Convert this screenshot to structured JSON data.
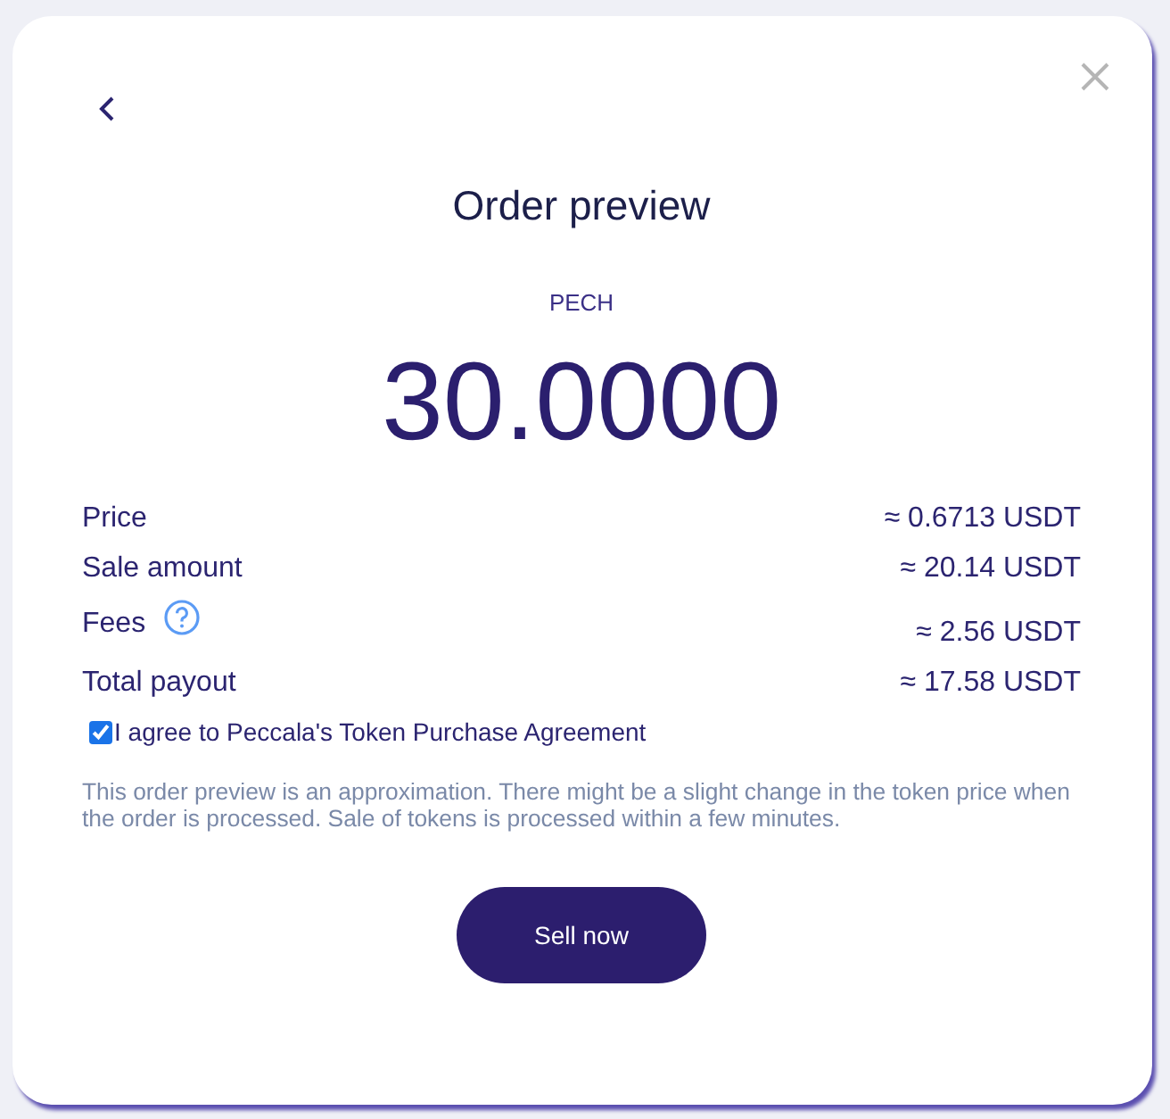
{
  "dialog": {
    "title": "Order preview",
    "token": "PECH",
    "amount": "30.0000",
    "rows": [
      {
        "kind": "plain",
        "label": "Price",
        "value": "≈ 0.6713 USDT"
      },
      {
        "kind": "plain",
        "label": "Sale amount",
        "value": "≈ 20.14 USDT"
      },
      {
        "kind": "help",
        "label": "Fees",
        "value": "≈ 2.56 USDT"
      },
      {
        "kind": "plain",
        "label": "Total payout",
        "value": "≈ 17.58 USDT"
      }
    ],
    "agreement": {
      "label": "I agree to Peccala's Token Purchase Agreement",
      "checked": true
    },
    "disclaimer": "This order preview is an approximation. There might be a slight change in the token price when the order is processed. Sale of tokens is processed within a few minutes.",
    "button": "Sell now"
  }
}
